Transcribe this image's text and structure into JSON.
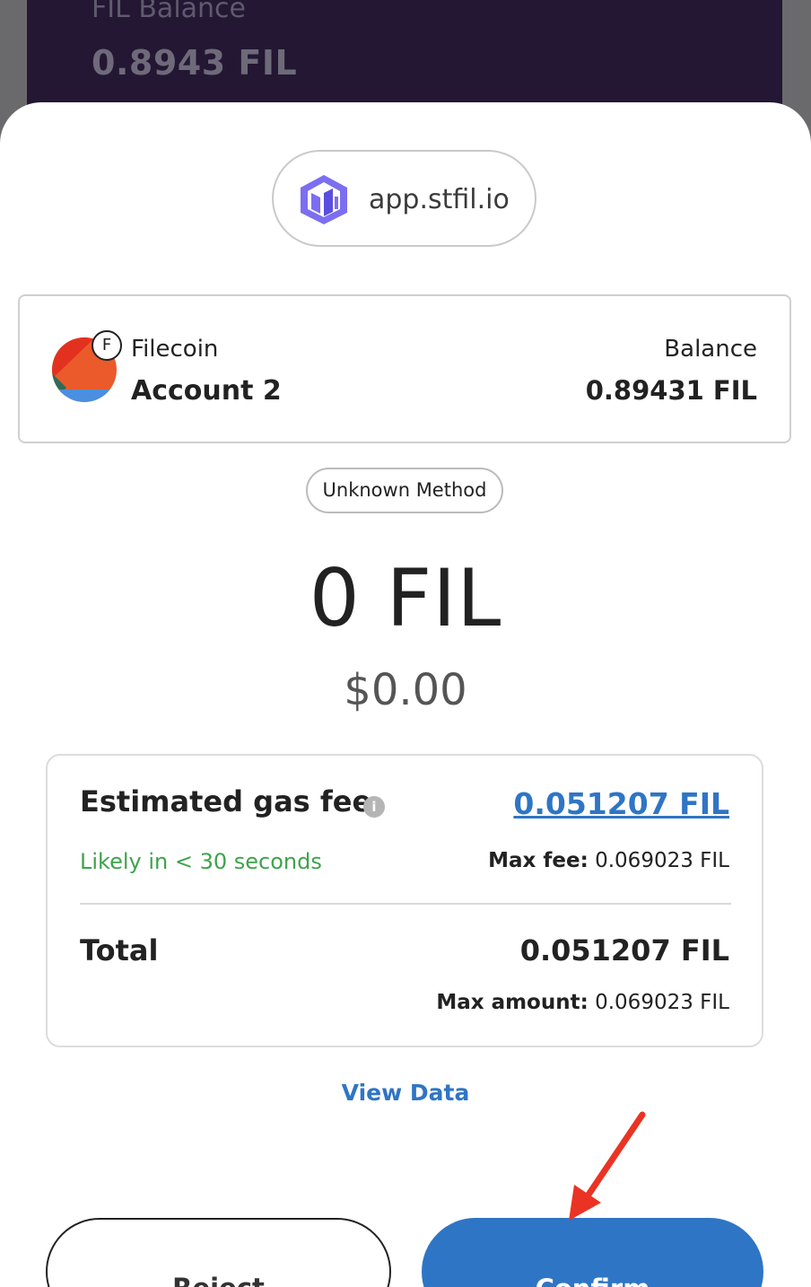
{
  "background": {
    "balance_label": "FIL Balance",
    "balance_value": "0.8943 FIL"
  },
  "origin": {
    "site": "app.stfil.io",
    "icon": "stfil-logo-icon"
  },
  "account": {
    "network_badge": "F",
    "network": "Filecoin",
    "name": "Account 2",
    "balance_label": "Balance",
    "balance_value": "0.89431 FIL"
  },
  "method": "Unknown Method",
  "amount": {
    "value": "0 FIL",
    "fiat": "$0.00"
  },
  "gas": {
    "title": "Estimated gas fee",
    "info_icon": "info-icon",
    "value": "0.051207 FIL",
    "likely": "Likely in < 30 seconds",
    "max_fee_label": "Max fee:",
    "max_fee_value": "0.069023 FIL"
  },
  "total": {
    "label": "Total",
    "value": "0.051207 FIL",
    "max_amount_label": "Max amount:",
    "max_amount_value": "0.069023 FIL"
  },
  "view_data": "View Data",
  "buttons": {
    "reject": "Reject",
    "confirm": "Confirm"
  },
  "colors": {
    "accent": "#2f75c5",
    "success": "#3ea34c",
    "annotation": "#ea3323"
  }
}
